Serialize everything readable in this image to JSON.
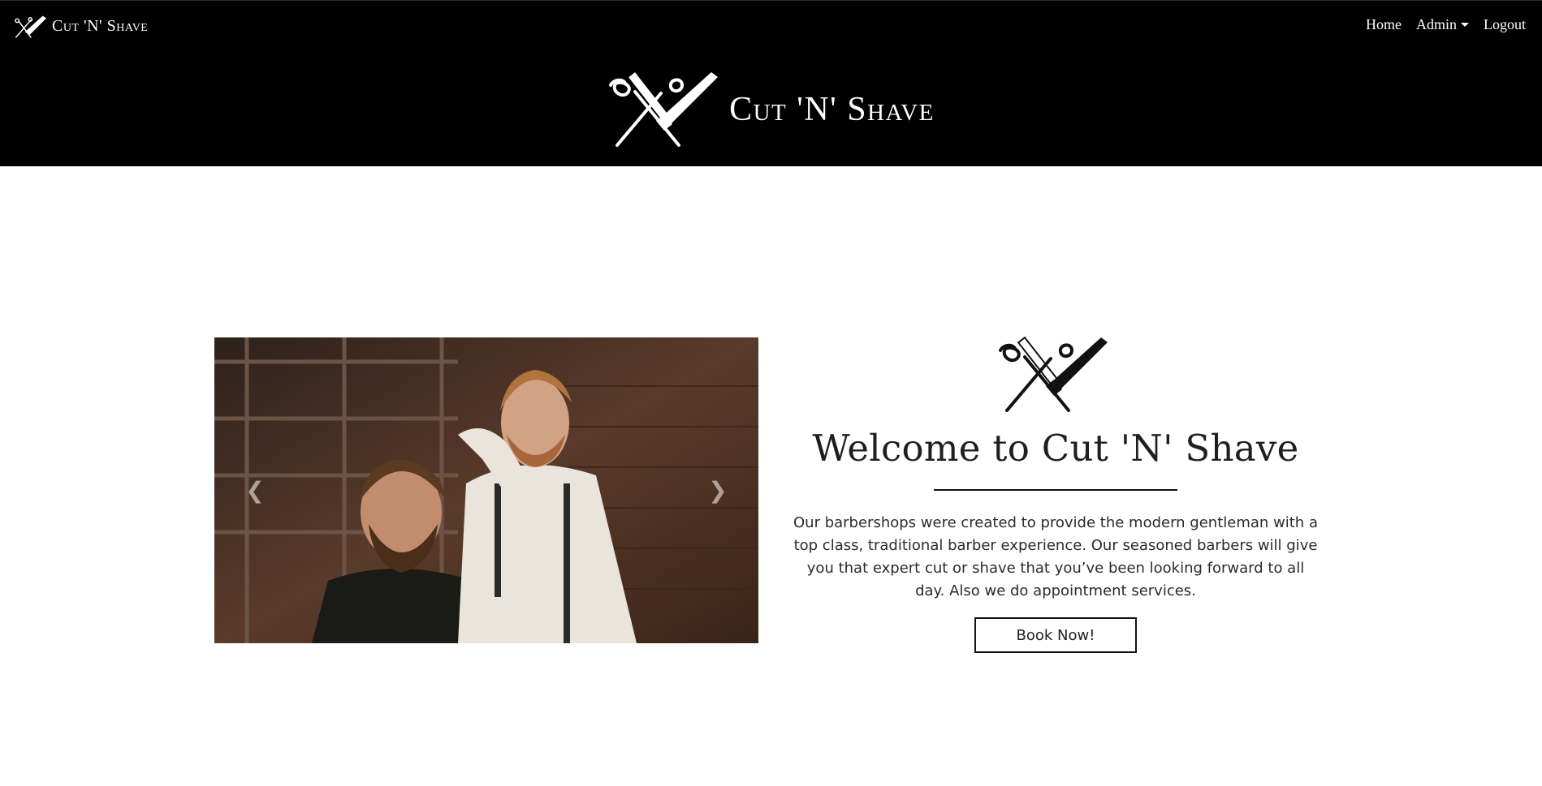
{
  "navbar": {
    "brand_text": "Cut 'N' Shave",
    "links": [
      {
        "label": "Home"
      },
      {
        "label": "Admin"
      },
      {
        "label": "Logout"
      }
    ]
  },
  "banner": {
    "title": "Cut 'N' Shave"
  },
  "carousel": {
    "image_subject": "barber cutting a bearded customer's hair",
    "prev_icon": "chevron-left-icon",
    "next_icon": "chevron-right-icon"
  },
  "welcome": {
    "title": "Welcome to Cut 'N' Shave",
    "body": "Our barbershops were created to provide the modern gentleman with a top class, traditional barber experience. Our seasoned barbers will give you that expert cut or shave that you’ve been looking forward to all day. Also we do appointment services.",
    "button_label": "Book Now!"
  },
  "colors": {
    "header_bg": "#000000",
    "page_bg": "#ffffff",
    "text_dark": "#1f1f1f"
  }
}
